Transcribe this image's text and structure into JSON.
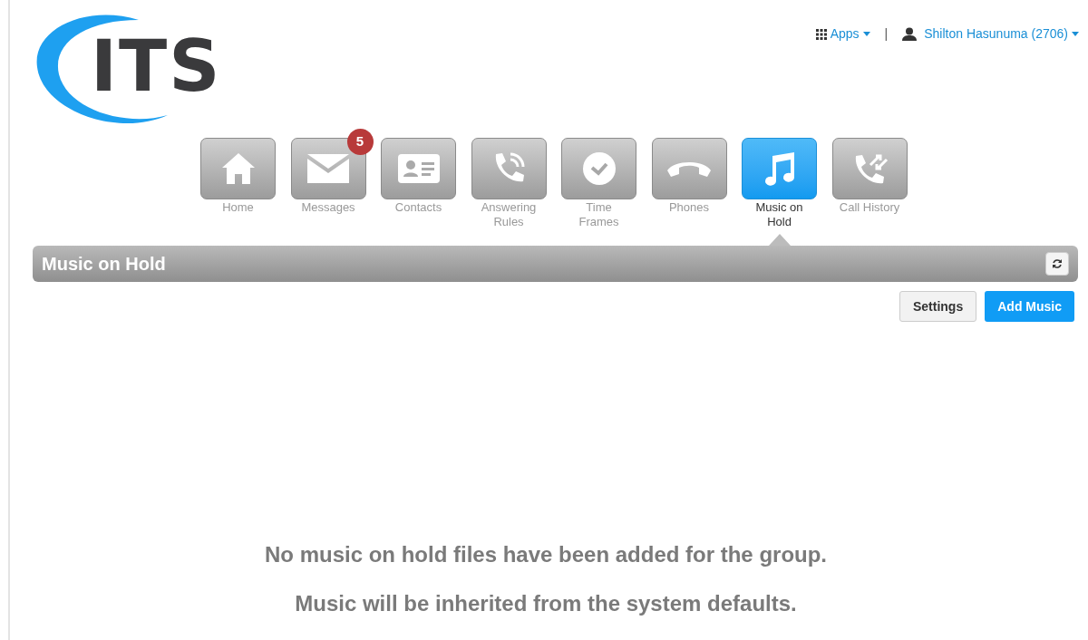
{
  "logo": {
    "text": "ITS"
  },
  "top_links": {
    "apps": "Apps",
    "separator": "|",
    "user": "Shilton Hasunuma (2706)"
  },
  "nav": [
    {
      "label": "Home",
      "selected": false
    },
    {
      "label": "Messages",
      "selected": false,
      "badge": "5"
    },
    {
      "label": "Contacts",
      "selected": false
    },
    {
      "label": "Answering Rules",
      "selected": false
    },
    {
      "label": "Time Frames",
      "selected": false
    },
    {
      "label": "Phones",
      "selected": false
    },
    {
      "label": "Music on Hold",
      "selected": true
    },
    {
      "label": "Call History",
      "selected": false
    }
  ],
  "panel": {
    "title": "Music on Hold",
    "buttons": [
      {
        "label": "Settings",
        "kind": "default"
      },
      {
        "label": "Add Music",
        "kind": "primary"
      }
    ],
    "empty_messages": [
      "No music on hold files have been added for the group.",
      "Music will be inherited from the system defaults."
    ]
  }
}
